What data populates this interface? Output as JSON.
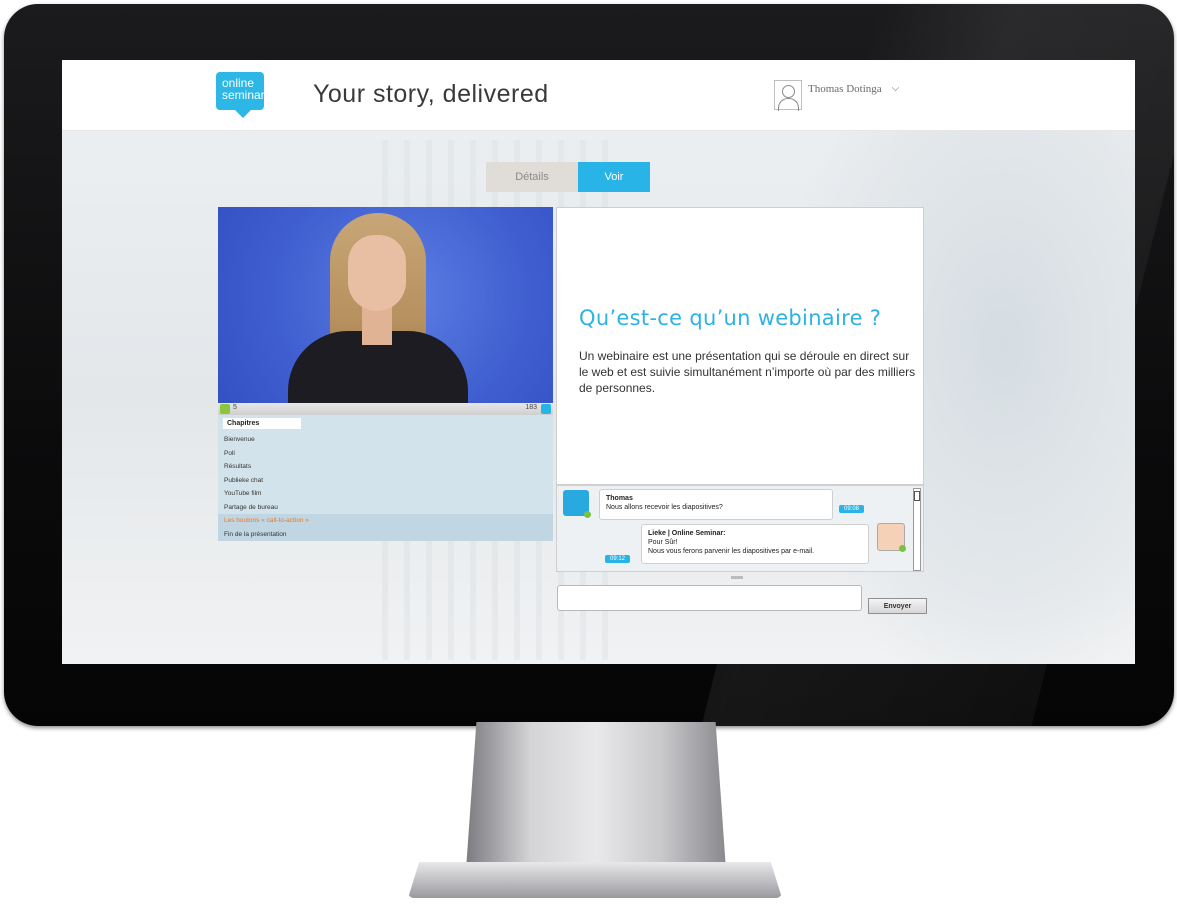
{
  "header": {
    "logo_line1": "online",
    "logo_line2": "seminar",
    "tagline": "Your story, delivered",
    "user_name": "Thomas Dotinga",
    "user_menu_icon": "chevron-down-icon"
  },
  "tabs": [
    {
      "label": "Détails",
      "active": false
    },
    {
      "label": "Voir",
      "active": true
    }
  ],
  "video_bar": {
    "like_count": "5",
    "view_count": "183"
  },
  "chapters": {
    "title": "Chapitres",
    "items": [
      {
        "label": "Bienvenue"
      },
      {
        "label": "Poll"
      },
      {
        "label": "Résultats"
      },
      {
        "label": "Publieke chat"
      },
      {
        "label": "YouTube film"
      },
      {
        "label": "Partage de bureau"
      },
      {
        "label": "Les boutons « call-to-action »",
        "active": true
      },
      {
        "label": "Fin de la présentation"
      }
    ]
  },
  "slide": {
    "title": "Qu’est-ce qu’un webinaire ?",
    "body": "Un webinaire est une présentation qui se déroule en direct sur le web et est suivie simultanément n’importe où par des milliers de personnes."
  },
  "chat": {
    "messages": [
      {
        "author": "Thomas",
        "line1": "Nous allons recevoir les diapositives?",
        "line2": "",
        "time": "09:08"
      },
      {
        "author": "Lieke | Online Seminar:",
        "line1": "Pour Sûr!",
        "line2": "Nous vous ferons parvenir les diapositives par e-mail.",
        "time": "09:12"
      }
    ],
    "input_placeholder": "",
    "send_label": "Envoyer"
  },
  "colors": {
    "accent": "#28b4e6",
    "chapter_active": "#f07622",
    "online_badge": "#7cc242"
  }
}
